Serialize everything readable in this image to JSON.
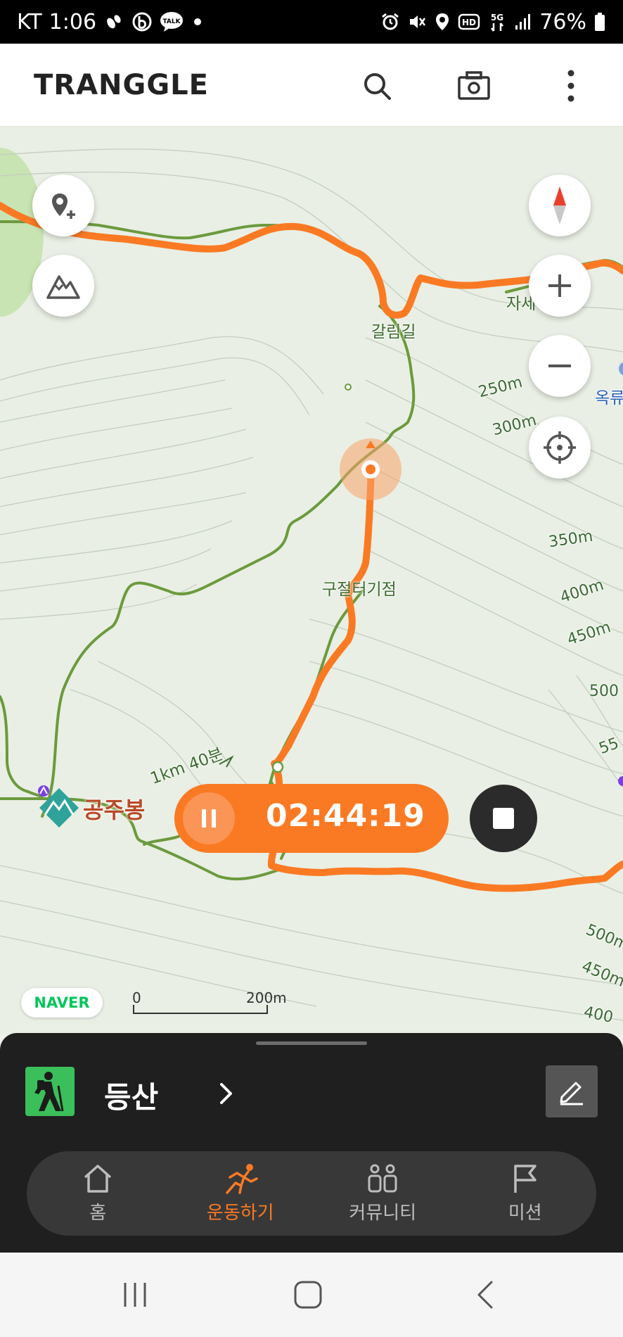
{
  "status_bar": {
    "carrier": "KT",
    "time": "1:06",
    "battery": "76%",
    "icons_left": [
      "footprint-icon",
      "b-app-icon",
      "talk-icon",
      "dot-icon"
    ],
    "icons_right": [
      "alarm-icon",
      "mute-icon",
      "location-icon",
      "hd-icon",
      "5g-icon",
      "signal-icon",
      "battery-icon"
    ],
    "talk_badge": "TALK",
    "hd_badge": "HD",
    "g5_badge": "5G"
  },
  "header": {
    "logo": "TRANGGLE",
    "actions": [
      "search-icon",
      "camera-icon",
      "more-vertical-icon"
    ]
  },
  "map": {
    "labels": {
      "trail_galrim": "갈림길",
      "junction": "구절터기점",
      "peak": "공주봉",
      "trail_info": "1km 40분",
      "cut_left": "자세",
      "cut_right": "옥류"
    },
    "contours": [
      "250m",
      "300m",
      "350m",
      "400m",
      "450m",
      "500",
      "55",
      "500m",
      "450m",
      "400"
    ],
    "controls": [
      "add-pin-icon",
      "mountain-icon",
      "compass-icon",
      "zoom-in-icon",
      "zoom-out-icon",
      "locate-icon"
    ],
    "route_color": "#fa7a24",
    "trail_color": "#6b9a3e"
  },
  "recording": {
    "elapsed": "02:44:19"
  },
  "map_footer": {
    "provider": "NAVER",
    "scale_start": "0",
    "scale_end": "200m"
  },
  "activity": {
    "name": "등산"
  },
  "tabs": [
    {
      "label": "홈",
      "icon": "home-icon",
      "active": false
    },
    {
      "label": "운동하기",
      "icon": "running-icon",
      "active": true
    },
    {
      "label": "커뮤니티",
      "icon": "community-icon",
      "active": false
    },
    {
      "label": "미션",
      "icon": "flag-icon",
      "active": false
    }
  ],
  "system_nav": [
    "recents-icon",
    "home-button-icon",
    "back-icon"
  ]
}
